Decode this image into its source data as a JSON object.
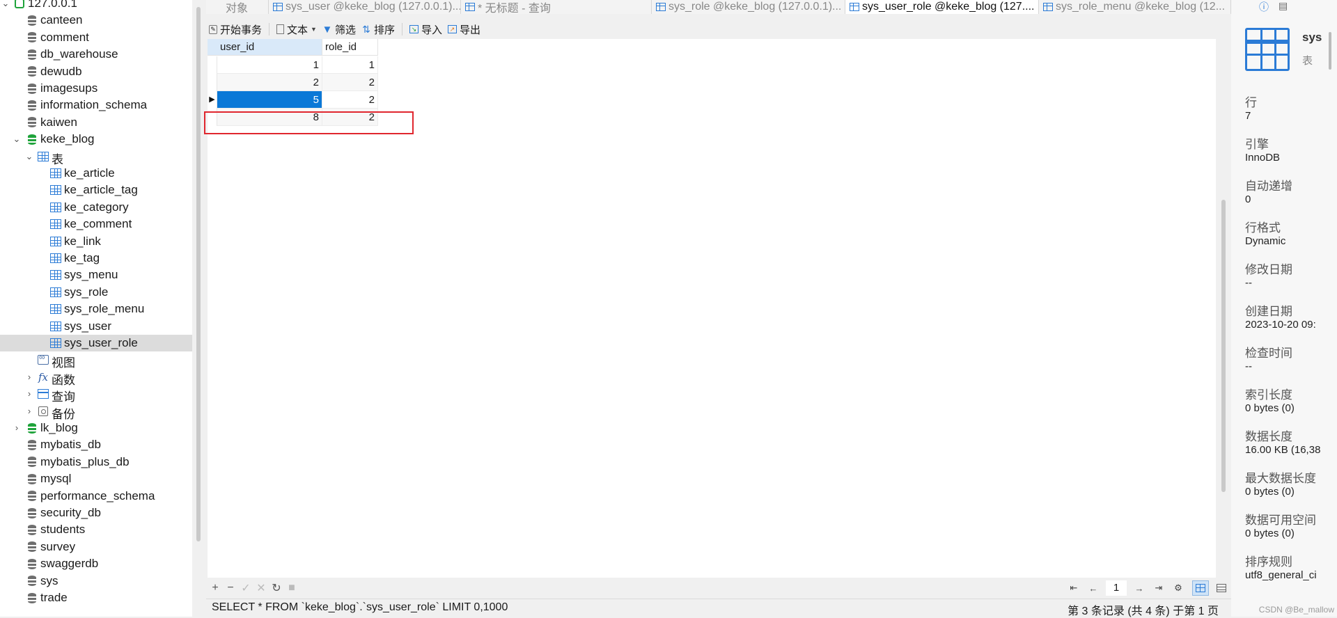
{
  "nav": {
    "connection": "127.0.0.1",
    "databases_top": [
      "canteen",
      "comment",
      "db_warehouse",
      "dewudb",
      "imagesups",
      "information_schema",
      "kaiwen"
    ],
    "open_db": "keke_blog",
    "tables_folder": "表",
    "tables": [
      "ke_article",
      "ke_article_tag",
      "ke_category",
      "ke_comment",
      "ke_link",
      "ke_tag",
      "sys_menu",
      "sys_role",
      "sys_role_menu",
      "sys_user",
      "sys_user_role"
    ],
    "selected_table": "sys_user_role",
    "views": "视图",
    "functions": "函数",
    "queries": "查询",
    "backups": "备份",
    "databases_bottom": [
      "lk_blog",
      "mybatis_db",
      "mybatis_plus_db",
      "mysql",
      "performance_schema",
      "security_db",
      "students",
      "survey",
      "swaggerdb",
      "sys",
      "trade"
    ]
  },
  "tabs": [
    {
      "label": "对象",
      "icon": "none"
    },
    {
      "label": "sys_user @keke_blog (127.0.0.1)...",
      "icon": "table-icon"
    },
    {
      "label": "* 无标题 - 查询",
      "icon": "query-icon"
    },
    {
      "label": "sys_role @keke_blog (127.0.0.1)...",
      "icon": "table-icon"
    },
    {
      "label": "sys_user_role @keke_blog (127....",
      "icon": "table-icon"
    },
    {
      "label": "sys_role_menu @keke_blog (12...",
      "icon": "table-icon"
    }
  ],
  "active_tab_index": 4,
  "toolbar": {
    "begin_tx": "开始事务",
    "text": "文本",
    "filter": "筛选",
    "sort": "排序",
    "import": "导入",
    "export": "导出"
  },
  "grid": {
    "columns": [
      "user_id",
      "role_id"
    ],
    "rows": [
      {
        "user_id": "1",
        "role_id": "1"
      },
      {
        "user_id": "2",
        "role_id": "2"
      },
      {
        "user_id": "5",
        "role_id": "2"
      },
      {
        "user_id": "8",
        "role_id": "2"
      }
    ],
    "selected_row_index": 2,
    "highlighted_row_index": 3,
    "highlight_color": "#e0262e",
    "selection_color": "#0a78d7"
  },
  "footer": {
    "page": "1"
  },
  "status": {
    "sql": "SELECT * FROM `keke_blog`.`sys_user_role` LIMIT 0,1000",
    "record": "第 3 条记录 (共 4 条) 于第 1 页"
  },
  "info": {
    "name": "sys",
    "type": "表",
    "fields": [
      {
        "label": "行",
        "value": "7"
      },
      {
        "label": "引擎",
        "value": "InnoDB"
      },
      {
        "label": "自动递增",
        "value": "0"
      },
      {
        "label": "行格式",
        "value": "Dynamic"
      },
      {
        "label": "修改日期",
        "value": "--"
      },
      {
        "label": "创建日期",
        "value": "2023-10-20 09:"
      },
      {
        "label": "检查时间",
        "value": "--"
      },
      {
        "label": "索引长度",
        "value": "0 bytes (0)"
      },
      {
        "label": "数据长度",
        "value": "16.00 KB (16,38"
      },
      {
        "label": "最大数据长度",
        "value": "0 bytes (0)"
      },
      {
        "label": "数据可用空间",
        "value": "0 bytes (0)"
      },
      {
        "label": "排序规则",
        "value": "utf8_general_ci"
      }
    ],
    "watermark": "CSDN @Be_mallow"
  }
}
